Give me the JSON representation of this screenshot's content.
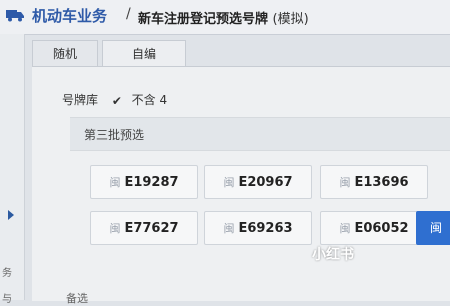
{
  "header": {
    "app_title": "机动车业务",
    "separator": "/",
    "page_title": "新车注册登记预选号牌",
    "page_title_suffix": "(模拟)"
  },
  "tabs": [
    {
      "label": "随机"
    },
    {
      "label": "自编"
    }
  ],
  "form": {
    "plate_library_label": "号牌库",
    "exclude_four_checked": true,
    "exclude_four_label": "不含 4"
  },
  "batch": {
    "label": "第三批预选"
  },
  "options": {
    "tag": "闽",
    "row1": [
      "E19287",
      "E20967",
      "E13696"
    ],
    "row2": [
      "E77627",
      "E69263",
      "E06052"
    ],
    "select_label": "闽"
  },
  "sidebar": {
    "fragments": [
      "务",
      "与"
    ]
  },
  "watermark": "小红书",
  "bottom_fragment": "备选"
}
